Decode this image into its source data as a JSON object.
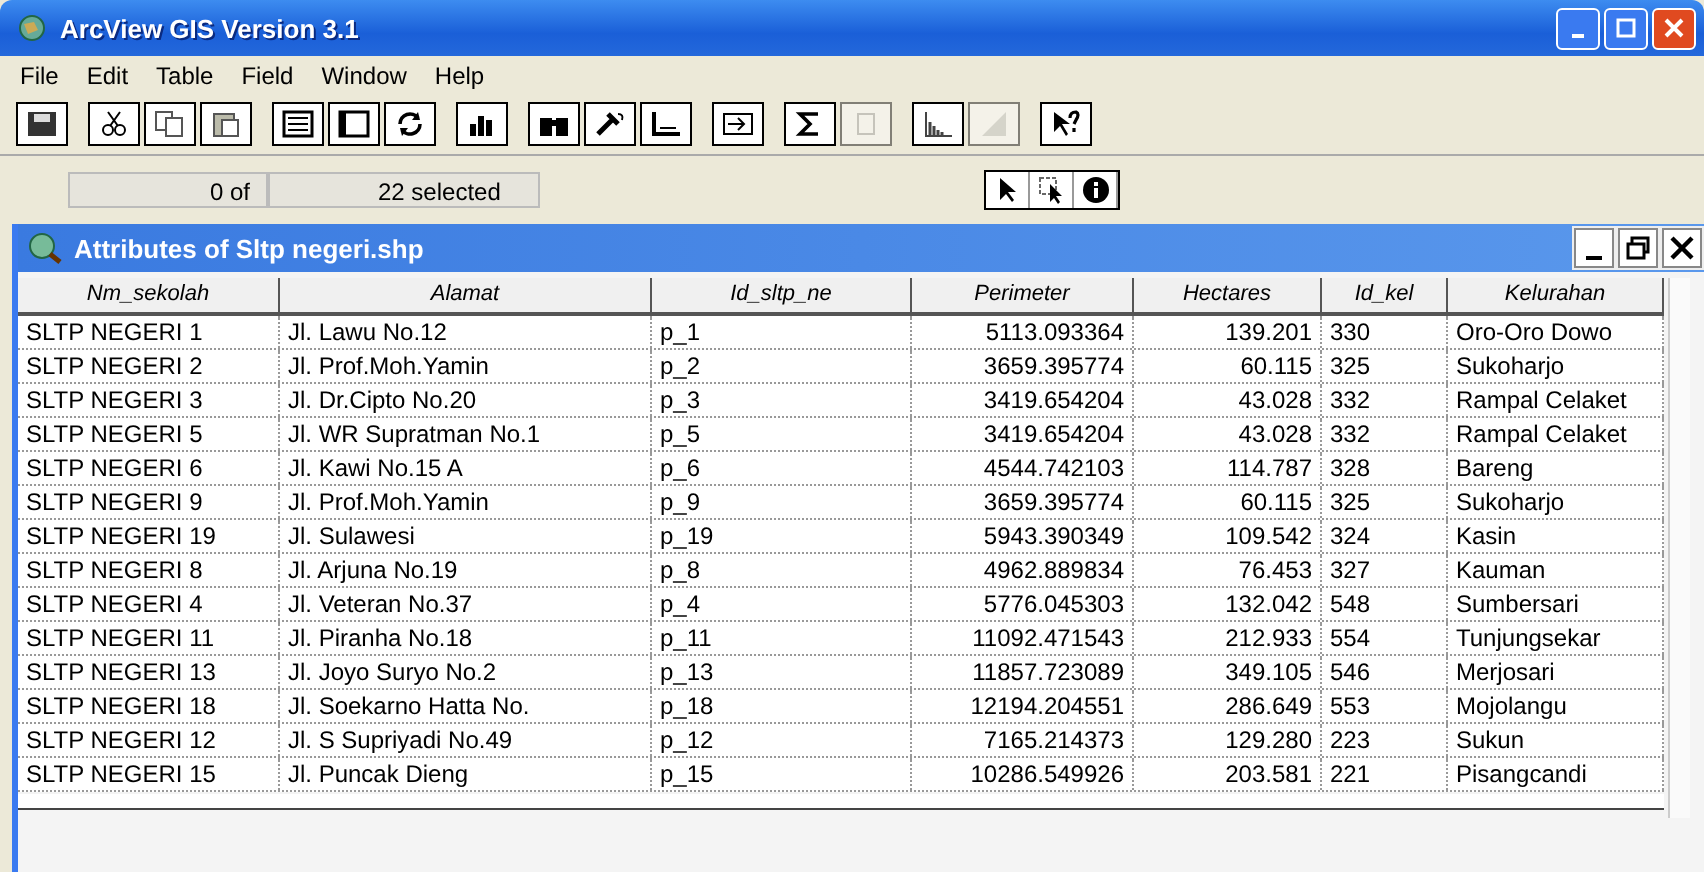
{
  "window": {
    "title": "ArcView GIS Version 3.1"
  },
  "menu": [
    "File",
    "Edit",
    "Table",
    "Field",
    "Window",
    "Help"
  ],
  "toolbar": [
    [
      {
        "disabled": false
      }
    ],
    [
      {
        "disabled": false
      },
      {
        "disabled": false
      },
      {
        "disabled": false
      }
    ],
    [
      {
        "disabled": false
      },
      {
        "disabled": false
      },
      {
        "disabled": false
      }
    ],
    [
      {
        "disabled": false
      }
    ],
    [
      {
        "disabled": false
      },
      {
        "disabled": false
      },
      {
        "disabled": false
      }
    ],
    [
      {
        "disabled": false
      }
    ],
    [
      {
        "disabled": false
      },
      {
        "disabled": true
      }
    ],
    [
      {
        "disabled": false
      },
      {
        "disabled": true
      }
    ],
    [
      {
        "disabled": false
      }
    ]
  ],
  "status": {
    "count": "0 of",
    "selected": "22 selected"
  },
  "tools": [
    {
      "selected": false
    },
    {
      "selected": false
    },
    {
      "selected": false
    }
  ],
  "table_window": {
    "title": "Attributes of Sltp negeri.shp"
  },
  "table": {
    "columns": [
      "Nm_sekolah",
      "Alamat",
      "Id_sltp_ne",
      "Perimeter",
      "Hectares",
      "Id_kel",
      "Kelurahan"
    ],
    "rows": [
      [
        "SLTP NEGERI 1",
        "Jl. Lawu No.12",
        "p_1",
        "5113.093364",
        "139.201",
        "330",
        "Oro-Oro Dowo"
      ],
      [
        "SLTP NEGERI 2",
        "Jl. Prof.Moh.Yamin",
        "p_2",
        "3659.395774",
        "60.115",
        "325",
        "Sukoharjo"
      ],
      [
        "SLTP NEGERI 3",
        "Jl. Dr.Cipto No.20",
        "p_3",
        "3419.654204",
        "43.028",
        "332",
        "Rampal Celaket"
      ],
      [
        "SLTP NEGERI 5",
        "Jl. WR Supratman No.1",
        "p_5",
        "3419.654204",
        "43.028",
        "332",
        "Rampal Celaket"
      ],
      [
        "SLTP NEGERI 6",
        "Jl. Kawi No.15 A",
        "p_6",
        "4544.742103",
        "114.787",
        "328",
        "Bareng"
      ],
      [
        "SLTP NEGERI 9",
        "Jl. Prof.Moh.Yamin",
        "p_9",
        "3659.395774",
        "60.115",
        "325",
        "Sukoharjo"
      ],
      [
        "SLTP NEGERI 19",
        "Jl. Sulawesi",
        "p_19",
        "5943.390349",
        "109.542",
        "324",
        "Kasin"
      ],
      [
        "SLTP NEGERI 8",
        "Jl. Arjuna No.19",
        "p_8",
        "4962.889834",
        "76.453",
        "327",
        "Kauman"
      ],
      [
        "SLTP NEGERI 4",
        "Jl. Veteran No.37",
        "p_4",
        "5776.045303",
        "132.042",
        "548",
        "Sumbersari"
      ],
      [
        "SLTP NEGERI 11",
        "Jl. Piranha No.18",
        "p_11",
        "11092.471543",
        "212.933",
        "554",
        "Tunjungsekar"
      ],
      [
        "SLTP NEGERI 13",
        "Jl. Joyo Suryo No.2",
        "p_13",
        "11857.723089",
        "349.105",
        "546",
        "Merjosari"
      ],
      [
        "SLTP NEGERI 18",
        "Jl. Soekarno Hatta No.",
        "p_18",
        "12194.204551",
        "286.649",
        "553",
        "Mojolangu"
      ],
      [
        "SLTP NEGERI 12",
        "Jl. S Supriyadi No.49",
        "p_12",
        "7165.214373",
        "129.280",
        "223",
        "Sukun"
      ],
      [
        "SLTP NEGERI 15",
        "Jl. Puncak Dieng",
        "p_15",
        "10286.549926",
        "203.581",
        "221",
        "Pisangcandi"
      ]
    ]
  }
}
